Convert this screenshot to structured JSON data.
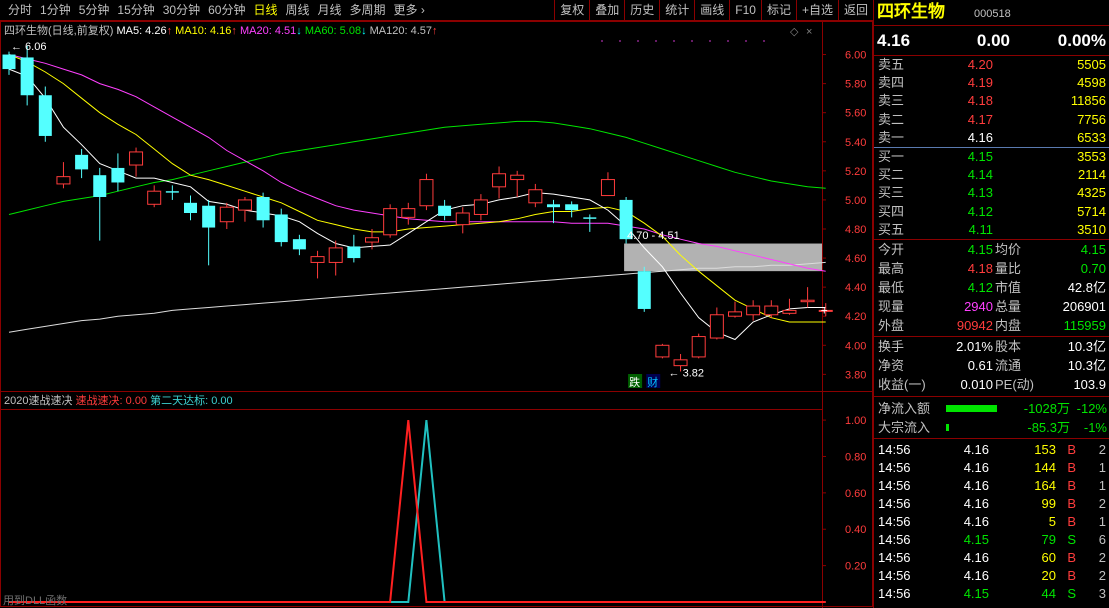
{
  "toolbar": {
    "periods": [
      "分时",
      "1分钟",
      "5分钟",
      "15分钟",
      "30分钟",
      "60分钟",
      "日线",
      "周线",
      "月线",
      "多周期",
      "更多 ›"
    ],
    "active_index": 6,
    "buttons": [
      "复权",
      "叠加",
      "历史",
      "统计",
      "画线",
      "F10",
      "标记",
      "+自选",
      "返回"
    ]
  },
  "main_legend": {
    "title": "四环生物(日线,前复权)",
    "ma": [
      {
        "label": "MA5: 4.26",
        "arrow": "↑",
        "color": "#ffffff"
      },
      {
        "label": "MA10: 4.16",
        "arrow": "↑",
        "color": "#ffff00"
      },
      {
        "label": "MA20: 4.51",
        "arrow": "↓",
        "color": "#ff40ff"
      },
      {
        "label": "MA60: 5.08",
        "arrow": "↓",
        "color": "#00e400"
      },
      {
        "label": "MA120: 4.57",
        "arrow": "↑",
        "color": "#c0c0c0"
      }
    ],
    "arrow_up_color": "#ff3c3c",
    "arrow_dn_color": "#00ffff"
  },
  "price_axis": [
    "6.00",
    "5.80",
    "5.60",
    "5.40",
    "5.20",
    "5.00",
    "4.80",
    "4.60",
    "4.40",
    "4.20",
    "4.00",
    "3.80"
  ],
  "annotations": {
    "high": "6.06",
    "low": "3.82",
    "box_label": "4.70 - 4.51",
    "tag1": "跌",
    "tag2": "财"
  },
  "sub_legend": {
    "title": "2020速战速决",
    "s1": "速战速决: 0.00",
    "s2": "第二天达标: 0.00"
  },
  "sub_axis": [
    "1.00",
    "0.80",
    "0.60",
    "0.40",
    "0.20"
  ],
  "bottom_hint": "用到DLL函数",
  "chart_data": {
    "type": "candlestick",
    "candles": [
      [
        6.0,
        5.9,
        6.02,
        5.86
      ],
      [
        5.98,
        5.72,
        6.06,
        5.65
      ],
      [
        5.72,
        5.44,
        5.78,
        5.4
      ],
      [
        5.11,
        5.16,
        5.26,
        5.08
      ],
      [
        5.31,
        5.21,
        5.35,
        5.15
      ],
      [
        5.17,
        5.02,
        5.22,
        4.72
      ],
      [
        5.22,
        5.12,
        5.32,
        5.06
      ],
      [
        5.24,
        5.33,
        5.36,
        5.16
      ],
      [
        4.97,
        5.06,
        5.1,
        4.95
      ],
      [
        5.06,
        5.05,
        5.1,
        5.0
      ],
      [
        4.98,
        4.91,
        5.03,
        4.86
      ],
      [
        4.96,
        4.81,
        5.0,
        4.55
      ],
      [
        4.85,
        4.95,
        4.98,
        4.8
      ],
      [
        4.93,
        5.0,
        5.02,
        4.85
      ],
      [
        5.02,
        4.86,
        5.05,
        4.81
      ],
      [
        4.9,
        4.71,
        4.94,
        4.68
      ],
      [
        4.73,
        4.66,
        4.76,
        4.62
      ],
      [
        4.57,
        4.61,
        4.65,
        4.46
      ],
      [
        4.57,
        4.67,
        4.72,
        4.48
      ],
      [
        4.68,
        4.6,
        4.76,
        4.57
      ],
      [
        4.71,
        4.74,
        4.8,
        4.66
      ],
      [
        4.76,
        4.94,
        4.97,
        4.74
      ],
      [
        4.88,
        4.94,
        4.98,
        4.83
      ],
      [
        4.96,
        5.14,
        5.18,
        4.93
      ],
      [
        4.96,
        4.89,
        5.0,
        4.86
      ],
      [
        4.83,
        4.91,
        4.95,
        4.77
      ],
      [
        4.9,
        5.0,
        5.04,
        4.86
      ],
      [
        5.09,
        5.18,
        5.23,
        5.01
      ],
      [
        5.14,
        5.17,
        5.2,
        5.02
      ],
      [
        4.98,
        5.07,
        5.11,
        4.95
      ],
      [
        4.97,
        4.95,
        5.0,
        4.84
      ],
      [
        4.97,
        4.93,
        4.99,
        4.88
      ],
      [
        4.88,
        4.87,
        4.9,
        4.78
      ],
      [
        5.03,
        5.14,
        5.19,
        5.03
      ],
      [
        5.0,
        4.73,
        5.02,
        4.7
      ],
      [
        4.51,
        4.25,
        4.54,
        4.23
      ],
      [
        3.92,
        4.0,
        4.01,
        3.91
      ],
      [
        3.86,
        3.9,
        3.94,
        3.82
      ],
      [
        3.92,
        4.06,
        4.08,
        3.91
      ],
      [
        4.05,
        4.21,
        4.26,
        4.04
      ],
      [
        4.2,
        4.23,
        4.3,
        4.19
      ],
      [
        4.21,
        4.27,
        4.31,
        4.17
      ],
      [
        4.21,
        4.27,
        4.31,
        4.19
      ],
      [
        4.22,
        4.24,
        4.32,
        4.21
      ],
      [
        4.3,
        4.31,
        4.4,
        4.26
      ],
      [
        4.24,
        4.24,
        4.29,
        4.2
      ]
    ],
    "ma5": [
      5.9,
      5.85,
      5.7,
      5.5,
      5.38,
      5.25,
      5.2,
      5.15,
      5.15,
      5.12,
      5.09,
      4.99,
      4.97,
      4.93,
      4.91,
      4.89,
      4.85,
      4.77,
      4.7,
      4.67,
      4.68,
      4.69,
      4.77,
      4.85,
      4.93,
      4.96,
      4.97,
      5.0,
      5.02,
      5.05,
      5.04,
      5.02,
      5.0,
      4.93,
      4.82,
      4.67,
      4.54,
      4.36,
      4.19,
      4.09,
      4.04,
      4.16,
      4.21,
      4.25,
      4.26,
      4.26
    ],
    "ma10": [
      6.0,
      5.95,
      5.88,
      5.8,
      5.7,
      5.6,
      5.52,
      5.45,
      5.35,
      5.25,
      5.17,
      5.14,
      5.1,
      5.06,
      5.02,
      4.98,
      4.92,
      4.86,
      4.83,
      4.8,
      4.78,
      4.78,
      4.8,
      4.81,
      4.82,
      4.83,
      4.84,
      4.85,
      4.87,
      4.9,
      4.92,
      4.92,
      4.94,
      4.95,
      4.92,
      4.84,
      4.75,
      4.62,
      4.51,
      4.41,
      4.31,
      4.25,
      4.19,
      4.16,
      4.16,
      4.16
    ],
    "ma20": [
      6.0,
      5.97,
      5.94,
      5.9,
      5.86,
      5.8,
      5.76,
      5.71,
      5.64,
      5.57,
      5.5,
      5.43,
      5.34,
      5.27,
      5.2,
      5.12,
      5.06,
      5.01,
      4.96,
      4.93,
      4.91,
      4.89,
      4.87,
      4.86,
      4.85,
      4.85,
      4.85,
      4.85,
      4.85,
      4.85,
      4.85,
      4.84,
      4.84,
      4.84,
      4.82,
      4.8,
      4.76,
      4.73,
      4.7,
      4.68,
      4.65,
      4.62,
      4.59,
      4.56,
      4.53,
      4.51
    ],
    "ma60": [
      4.9,
      4.93,
      4.96,
      4.99,
      5.01,
      5.03,
      5.06,
      5.09,
      5.12,
      5.14,
      5.17,
      5.2,
      5.23,
      5.26,
      5.29,
      5.32,
      5.34,
      5.36,
      5.38,
      5.4,
      5.42,
      5.44,
      5.46,
      5.48,
      5.5,
      5.51,
      5.52,
      5.53,
      5.54,
      5.54,
      5.53,
      5.51,
      5.49,
      5.46,
      5.43,
      5.39,
      5.35,
      5.31,
      5.27,
      5.23,
      5.19,
      5.16,
      5.13,
      5.11,
      5.09,
      5.08
    ],
    "ma120": [
      4.09,
      4.11,
      4.13,
      4.15,
      4.17,
      4.18,
      4.2,
      4.21,
      4.22,
      4.24,
      4.25,
      4.26,
      4.27,
      4.28,
      4.29,
      4.3,
      4.31,
      4.32,
      4.33,
      4.34,
      4.35,
      4.36,
      4.37,
      4.38,
      4.39,
      4.4,
      4.41,
      4.42,
      4.43,
      4.44,
      4.45,
      4.46,
      4.47,
      4.48,
      4.49,
      4.5,
      4.51,
      4.52,
      4.53,
      4.53,
      4.54,
      4.54,
      4.55,
      4.55,
      4.56,
      4.57
    ],
    "ylim": [
      3.72,
      6.1
    ],
    "signal_red": [
      0,
      0,
      0,
      0,
      0,
      0,
      0,
      0,
      0,
      0,
      0,
      0,
      0,
      0,
      0,
      0,
      0,
      0,
      0,
      0,
      0,
      0,
      1,
      0,
      0,
      0,
      0,
      0,
      0,
      0,
      0,
      0,
      0,
      0,
      0,
      0,
      0,
      0,
      0,
      0,
      0,
      0,
      0,
      0,
      0,
      0
    ],
    "signal_cyan": [
      0,
      0,
      0,
      0,
      0,
      0,
      0,
      0,
      0,
      0,
      0,
      0,
      0,
      0,
      0,
      0,
      0,
      0,
      0,
      0,
      0,
      0,
      0,
      1,
      0,
      0,
      0,
      0,
      0,
      0,
      0,
      0,
      0,
      0,
      0,
      0,
      0,
      0,
      0,
      0,
      0,
      0,
      0,
      0,
      0,
      0
    ],
    "sub_ylim": [
      0,
      1.05
    ]
  },
  "quote": {
    "name": "四环生物",
    "code": "000518",
    "price": "4.16",
    "change": "0.00",
    "pct": "0.00%",
    "asks": [
      {
        "l": "卖五",
        "p": "4.20",
        "v": "5505",
        "c": "red"
      },
      {
        "l": "卖四",
        "p": "4.19",
        "v": "4598",
        "c": "red"
      },
      {
        "l": "卖三",
        "p": "4.18",
        "v": "11856",
        "c": "red"
      },
      {
        "l": "卖二",
        "p": "4.17",
        "v": "7756",
        "c": "red"
      },
      {
        "l": "卖一",
        "p": "4.16",
        "v": "6533",
        "c": "wht"
      }
    ],
    "bids": [
      {
        "l": "买一",
        "p": "4.15",
        "v": "3553",
        "c": "grn"
      },
      {
        "l": "买二",
        "p": "4.14",
        "v": "2114",
        "c": "grn"
      },
      {
        "l": "买三",
        "p": "4.13",
        "v": "4325",
        "c": "grn"
      },
      {
        "l": "买四",
        "p": "4.12",
        "v": "5714",
        "c": "grn"
      },
      {
        "l": "买五",
        "p": "4.11",
        "v": "3510",
        "c": "grn"
      }
    ],
    "stats": [
      {
        "l1": "今开",
        "v1": "4.15",
        "c1": "grn",
        "l2": "均价",
        "v2": "4.15",
        "c2": "grn"
      },
      {
        "l1": "最高",
        "v1": "4.18",
        "c1": "red",
        "l2": "量比",
        "v2": "0.70",
        "c2": "grn"
      },
      {
        "l1": "最低",
        "v1": "4.12",
        "c1": "grn",
        "l2": "市值",
        "v2": "42.8亿",
        "c2": "wht"
      },
      {
        "l1": "现量",
        "v1": "2940",
        "c1": "mag",
        "l2": "总量",
        "v2": "206901",
        "c2": "wht"
      },
      {
        "l1": "外盘",
        "v1": "90942",
        "c1": "red",
        "l2": "内盘",
        "v2": "115959",
        "c2": "grn"
      }
    ],
    "stats2": [
      {
        "l1": "换手",
        "v1": "2.01%",
        "l2": "股本",
        "v2": "10.3亿"
      },
      {
        "l1": "净资",
        "v1": "0.61",
        "l2": "流通",
        "v2": "10.3亿"
      },
      {
        "l1": "收益(一)",
        "v1": "0.010",
        "l2": "PE(动)",
        "v2": "103.9"
      }
    ],
    "flows": [
      {
        "l": "净流入额",
        "v": "-1028万",
        "p": "-12%",
        "bar": 0.95
      },
      {
        "l": "大宗流入",
        "v": "-85.3万",
        "p": "-1%",
        "bar": 0.05
      }
    ],
    "ticks": [
      {
        "t": "14:56",
        "p": "4.16",
        "pc": "wht",
        "v": "153",
        "vc": "yel",
        "s": "B",
        "sc": "red",
        "n": "2"
      },
      {
        "t": "14:56",
        "p": "4.16",
        "pc": "wht",
        "v": "144",
        "vc": "yel",
        "s": "B",
        "sc": "red",
        "n": "1"
      },
      {
        "t": "14:56",
        "p": "4.16",
        "pc": "wht",
        "v": "164",
        "vc": "yel",
        "s": "B",
        "sc": "red",
        "n": "1"
      },
      {
        "t": "14:56",
        "p": "4.16",
        "pc": "wht",
        "v": "99",
        "vc": "yel",
        "s": "B",
        "sc": "red",
        "n": "2"
      },
      {
        "t": "14:56",
        "p": "4.16",
        "pc": "wht",
        "v": "5",
        "vc": "yel",
        "s": "B",
        "sc": "red",
        "n": "1"
      },
      {
        "t": "14:56",
        "p": "4.15",
        "pc": "grn",
        "v": "79",
        "vc": "grn",
        "s": "S",
        "sc": "grn",
        "n": "6"
      },
      {
        "t": "14:56",
        "p": "4.16",
        "pc": "wht",
        "v": "60",
        "vc": "yel",
        "s": "B",
        "sc": "red",
        "n": "2"
      },
      {
        "t": "14:56",
        "p": "4.16",
        "pc": "wht",
        "v": "20",
        "vc": "yel",
        "s": "B",
        "sc": "red",
        "n": "2"
      },
      {
        "t": "14:56",
        "p": "4.15",
        "pc": "grn",
        "v": "44",
        "vc": "grn",
        "s": "S",
        "sc": "grn",
        "n": "3"
      }
    ]
  }
}
